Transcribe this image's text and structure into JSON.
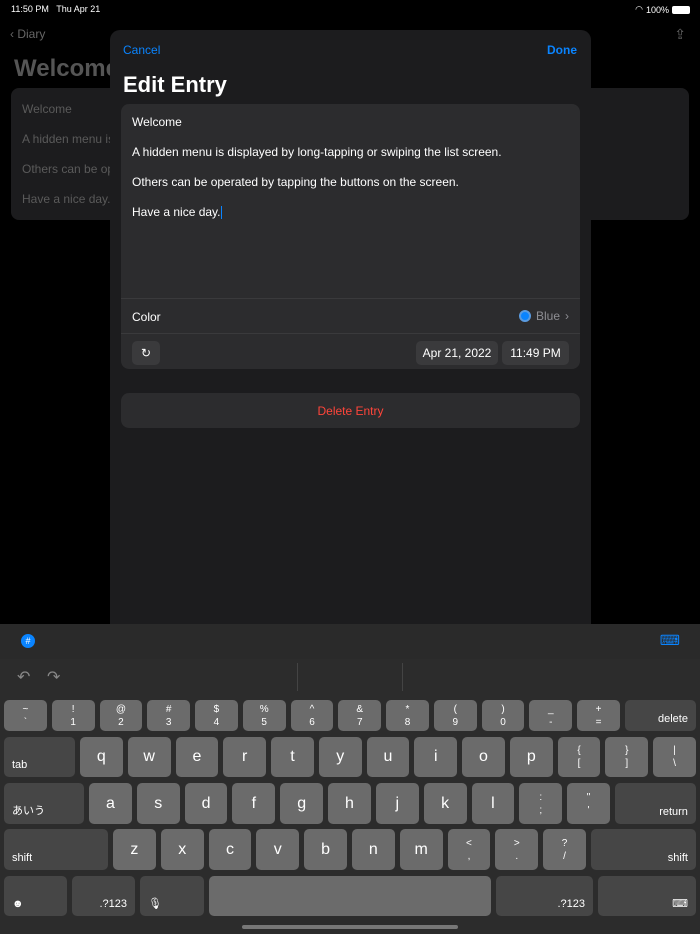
{
  "status": {
    "time": "11:50 PM",
    "date": "Thu Apr 21",
    "battery": "100%"
  },
  "background": {
    "back_label": "Diary",
    "title": "Welcome",
    "items": [
      "Welcome",
      "A hidden menu is",
      "Others can be op",
      "Have a nice day."
    ]
  },
  "modal": {
    "cancel": "Cancel",
    "done": "Done",
    "title": "Edit Entry",
    "body_lines": [
      "Welcome",
      "A hidden menu is displayed by long-tapping or swiping the list screen.",
      "Others can be operated by tapping the buttons on the screen.",
      "Have a nice day."
    ],
    "color_label": "Color",
    "color_value": "Blue",
    "color_hex": "#0a84ff",
    "date": "Apr 21, 2022",
    "time": "11:49 PM",
    "delete": "Delete Entry"
  },
  "keyboard": {
    "row1": [
      [
        "~",
        "`"
      ],
      [
        "!",
        "1"
      ],
      [
        "@",
        "2"
      ],
      [
        "#",
        "3"
      ],
      [
        "$",
        "4"
      ],
      [
        "%",
        "5"
      ],
      [
        "^",
        "6"
      ],
      [
        "&",
        "7"
      ],
      [
        "*",
        "8"
      ],
      [
        "(",
        "9"
      ],
      [
        ")",
        "0"
      ],
      [
        "_",
        "-"
      ],
      [
        "+",
        "="
      ]
    ],
    "delete": "delete",
    "tab": "tab",
    "row2": [
      "q",
      "w",
      "e",
      "r",
      "t",
      "y",
      "u",
      "i",
      "o",
      "p"
    ],
    "row2_sym": [
      [
        "{",
        "["
      ],
      [
        "}",
        "]"
      ],
      [
        "|",
        "\\"
      ]
    ],
    "kana": "あいう",
    "row3": [
      "a",
      "s",
      "d",
      "f",
      "g",
      "h",
      "j",
      "k",
      "l"
    ],
    "row3_sym": [
      [
        ":",
        ";"
      ],
      [
        "\"",
        "'"
      ]
    ],
    "return": "return",
    "shift": "shift",
    "row4": [
      "z",
      "x",
      "c",
      "v",
      "b",
      "n",
      "m"
    ],
    "row4_sym": [
      [
        "<",
        ","
      ],
      [
        ">",
        "."
      ],
      [
        "?",
        "/"
      ]
    ],
    "num": ".?123"
  }
}
